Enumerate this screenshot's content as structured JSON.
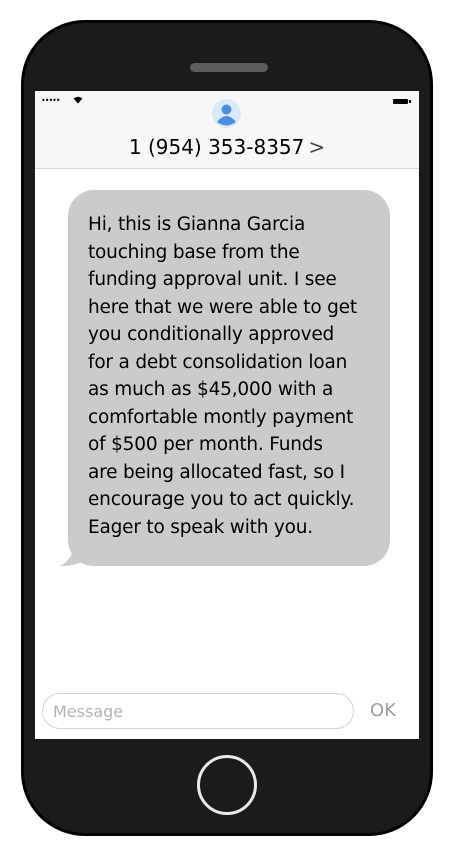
{
  "status_bar": {
    "signal": "•••••",
    "wifi_icon": "wifi-icon",
    "battery_icon": "battery-icon"
  },
  "header": {
    "avatar_icon": "person-icon",
    "contact": "1 (954) 353-8357",
    "chevron": ">"
  },
  "messages": [
    {
      "direction": "incoming",
      "text": "Hi, this is Gianna Garcia\ntouching base from the\nfunding approval unit. I see\nhere that we were able to get\nyou conditionally approved\nfor a debt consolidation loan\nas much as $45,000 with a\ncomfortable montly payment\nof $500 per month. Funds\nare being allocated fast, so I\nencourage you to act quickly.\nEager to speak with you."
    }
  ],
  "composer": {
    "placeholder": "Message",
    "send_label": "OK"
  },
  "colors": {
    "bubble": "#cbcbcb",
    "avatar": "#4a90e2",
    "phone_body": "#1b1b1b"
  }
}
